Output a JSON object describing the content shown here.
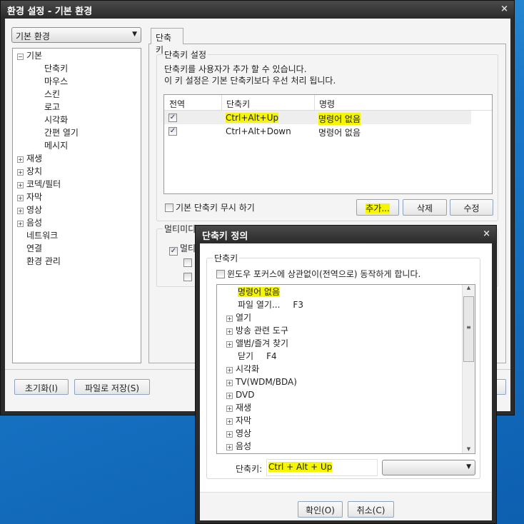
{
  "main": {
    "title": "환경 설정 - 기본 환경",
    "close": "×",
    "category_select": "기본 환경",
    "tree": [
      {
        "label": "기본",
        "toggle": "−",
        "children": [
          "단축키",
          "마우스",
          "스킨",
          "로고",
          "시각화",
          "간편 열기",
          "메시지"
        ]
      },
      {
        "label": "재생",
        "toggle": "+"
      },
      {
        "label": "장치",
        "toggle": "+"
      },
      {
        "label": "코덱/필터",
        "toggle": "+"
      },
      {
        "label": "자막",
        "toggle": "+"
      },
      {
        "label": "영상",
        "toggle": "+"
      },
      {
        "label": "음성",
        "toggle": "+"
      },
      {
        "label": "네트워크"
      },
      {
        "label": "연결"
      },
      {
        "label": "환경 관리"
      }
    ],
    "tab": "단축키",
    "group_title": "단축키 설정",
    "desc1": "단축키를 사용자가 추가 할 수 있습니다.",
    "desc2": "이 키 설정은 기본 단축키보다 우선 처리 됩니다.",
    "columns": [
      "전역",
      "단축키",
      "명령"
    ],
    "rows": [
      {
        "global": true,
        "key": "Ctrl+Alt+Up",
        "command": "명령어 없음"
      },
      {
        "global": true,
        "key": "Ctrl+Alt+Down",
        "command": "명령어 없음"
      }
    ],
    "ignore_default": "기본 단축키 무시 하기",
    "add": "추가...",
    "delete": "삭제",
    "edit": "수정",
    "multimedia_group": "멀티미디",
    "multimedia_check": "멀티",
    "reset": "초기화(I)",
    "save_file": "파일로 저장(S)"
  },
  "dialog": {
    "title": "단축키 정의",
    "close": "×",
    "group": "단축키",
    "global_check": "윈도우 포커스에 상관없이(전역으로) 동작하게 합니다.",
    "commands": [
      {
        "label": "명령어 없음",
        "key": ""
      },
      {
        "label": "파일 열기...",
        "key": "F3"
      },
      {
        "label": "열기",
        "toggle": "+"
      },
      {
        "label": "방송 관련 도구",
        "toggle": "+"
      },
      {
        "label": "앨범/즐겨 찾기",
        "toggle": "+"
      },
      {
        "label": "닫기",
        "key": "F4"
      },
      {
        "label": "시각화",
        "toggle": "+"
      },
      {
        "label": "TV(WDM/BDA)",
        "toggle": "+"
      },
      {
        "label": "DVD",
        "toggle": "+"
      },
      {
        "label": "재생",
        "toggle": "+"
      },
      {
        "label": "자막",
        "toggle": "+"
      },
      {
        "label": "영상",
        "toggle": "+"
      },
      {
        "label": "음성",
        "toggle": "+"
      }
    ],
    "shortcut_label": "단축키:",
    "shortcut_value": "Ctrl + Alt + Up",
    "ok": "확인(O)",
    "cancel": "취소(C)"
  }
}
